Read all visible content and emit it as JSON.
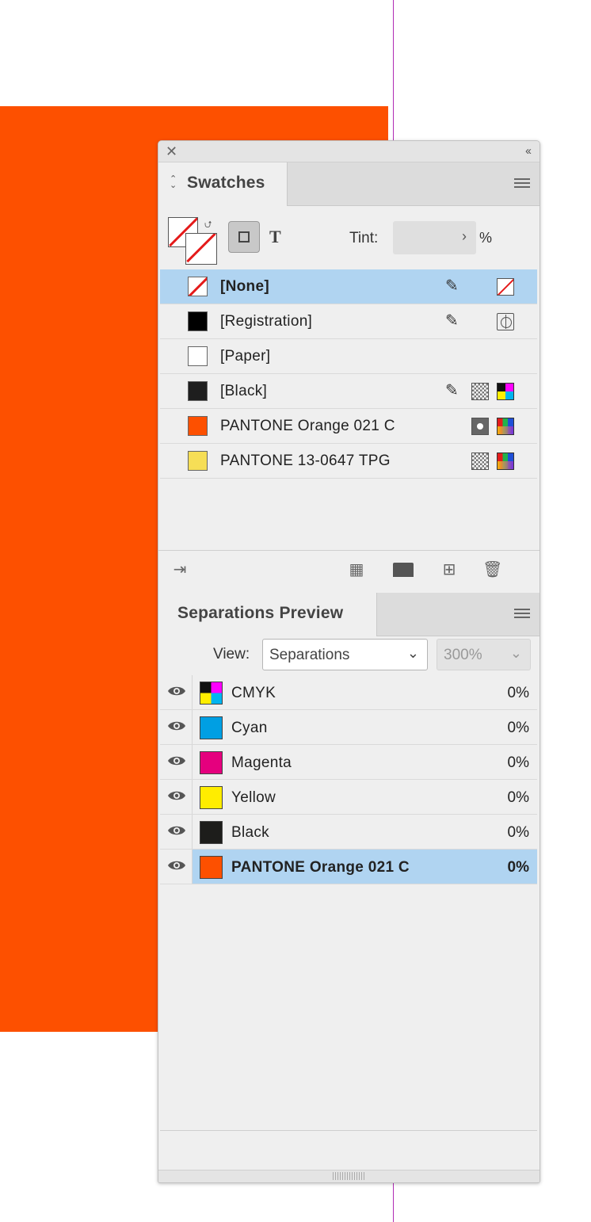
{
  "canvas": {
    "accent_color": "#fd5000",
    "guide_color": "#b12bb5"
  },
  "panel": {
    "close_glyph": "✕",
    "collapse_glyph": "‹‹"
  },
  "swatches": {
    "tab_glyph": "⌃⌄",
    "title": "Swatches",
    "tint_label": "Tint:",
    "tint_value": "",
    "tint_unit": "%",
    "text_toggle": "T",
    "items": [
      {
        "label": "[None]",
        "color": "none",
        "selected": true,
        "icons": [
          "pencil-slash-icon",
          "none-swatch-icon"
        ]
      },
      {
        "label": "[Registration]",
        "color": "#000000",
        "selected": false,
        "icons": [
          "pencil-slash-icon",
          "registration-mark-icon"
        ]
      },
      {
        "label": "[Paper]",
        "color": "#ffffff",
        "selected": false,
        "icons": []
      },
      {
        "label": "[Black]",
        "color": "#1e1e1e",
        "selected": false,
        "icons": [
          "pencil-slash-icon",
          "process-color-icon",
          "cmyk-mode-icon"
        ]
      },
      {
        "label": "PANTONE Orange 021 C",
        "color": "#fd5000",
        "selected": false,
        "icons": [
          "spot-color-icon",
          "lab-mode-icon"
        ]
      },
      {
        "label": "PANTONE 13-0647 TPG",
        "color": "#f6de56",
        "selected": false,
        "icons": [
          "process-color-icon",
          "lab-mode-icon"
        ]
      }
    ],
    "footer_icons": [
      "import-swatches-icon",
      "swatch-views-icon",
      "new-color-group-icon",
      "new-swatch-icon",
      "delete-swatch-icon"
    ]
  },
  "separations": {
    "title": "Separations Preview",
    "view_label": "View:",
    "view_value": "Separations",
    "zoom_value": "300%",
    "items": [
      {
        "label": "CMYK",
        "color": "cmyk",
        "percent": "0%",
        "selected": false
      },
      {
        "label": "Cyan",
        "color": "#009fe3",
        "percent": "0%",
        "selected": false
      },
      {
        "label": "Magenta",
        "color": "#e5007e",
        "percent": "0%",
        "selected": false
      },
      {
        "label": "Yellow",
        "color": "#ffed00",
        "percent": "0%",
        "selected": false
      },
      {
        "label": "Black",
        "color": "#1d1d1b",
        "percent": "0%",
        "selected": false
      },
      {
        "label": "PANTONE Orange 021 C",
        "color": "#fd5000",
        "percent": "0%",
        "selected": true
      }
    ]
  }
}
